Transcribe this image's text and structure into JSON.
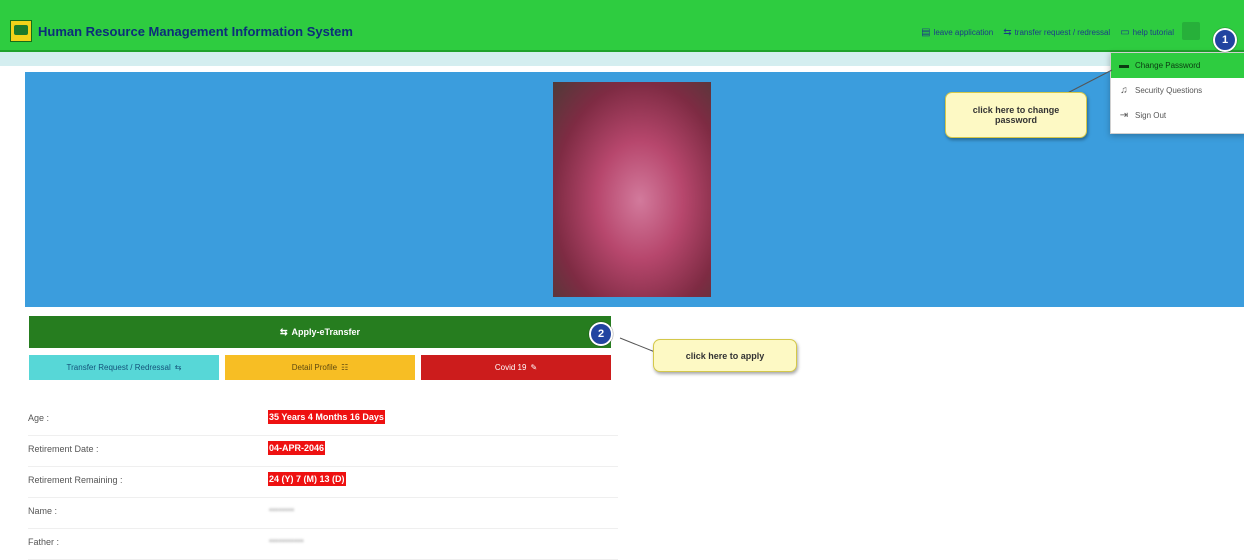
{
  "header": {
    "app_title": "Human Resource Management Information System",
    "nav": [
      {
        "label": "leave application",
        "icon": "calendar-icon"
      },
      {
        "label": "transfer request / redressal",
        "icon": "transfer-icon"
      },
      {
        "label": "help tutorial",
        "icon": "monitor-icon"
      }
    ]
  },
  "dropdown": {
    "items": [
      {
        "label": "Change Password",
        "icon": "key-icon"
      },
      {
        "label": "Security Questions",
        "icon": "bell-icon"
      },
      {
        "label": "Sign Out",
        "icon": "signout-icon"
      }
    ]
  },
  "callouts": {
    "change_password": "click here to change password",
    "apply": "click here to apply",
    "badge1": "1",
    "badge2": "2"
  },
  "buttons": {
    "apply": "Apply-eTransfer",
    "transfer": "Transfer Request / Redressal",
    "detail": "Detail Profile",
    "covid": "Covid 19"
  },
  "info": [
    {
      "label": "Age :",
      "value": "35 Years 4 Months 16 Days"
    },
    {
      "label": "Retirement Date :",
      "value": "04-APR-2046"
    },
    {
      "label": "Retirement Remaining :",
      "value": "24 (Y) 7 (M) 13 (D)"
    },
    {
      "label": "Name :",
      "value": "••••••••"
    },
    {
      "label": "Father :",
      "value": "•••••••••••"
    }
  ],
  "colors": {
    "header": "#2ecc40",
    "banner": "#3b9ddd",
    "apply": "#267d1f",
    "transfer": "#57d7d7",
    "detail": "#f7be24",
    "covid": "#cc1c1c"
  }
}
